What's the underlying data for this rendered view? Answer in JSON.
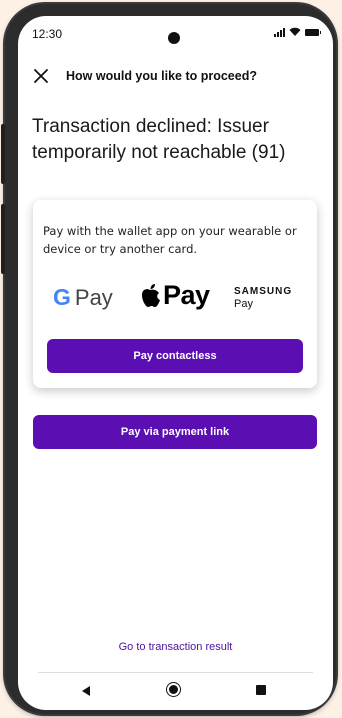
{
  "status_bar": {
    "time": "12:30"
  },
  "header": {
    "title": "How would you like to proceed?"
  },
  "message": {
    "text": "Transaction declined: Issuer temporarily not reachable (91)"
  },
  "wallet_card": {
    "text": "Pay with the wallet app on your wearable or device or try another card.",
    "google_pay_g": "G",
    "google_pay_label": "Pay",
    "apple_pay_label": "Pay",
    "samsung_pay_brand": "SAMSUNG",
    "samsung_pay_label": "Pay",
    "contactless_button": "Pay contactless"
  },
  "payment_link_button": "Pay via payment link",
  "result_link": "Go to transaction result",
  "icons": [
    "close-icon",
    "signal-icon",
    "wifi-icon",
    "battery-icon",
    "apple-icon",
    "back-icon",
    "home-icon",
    "recents-icon"
  ],
  "colors": {
    "accent": "#5b0fb3",
    "link": "#4b149e",
    "background": "#fdf1e6"
  }
}
